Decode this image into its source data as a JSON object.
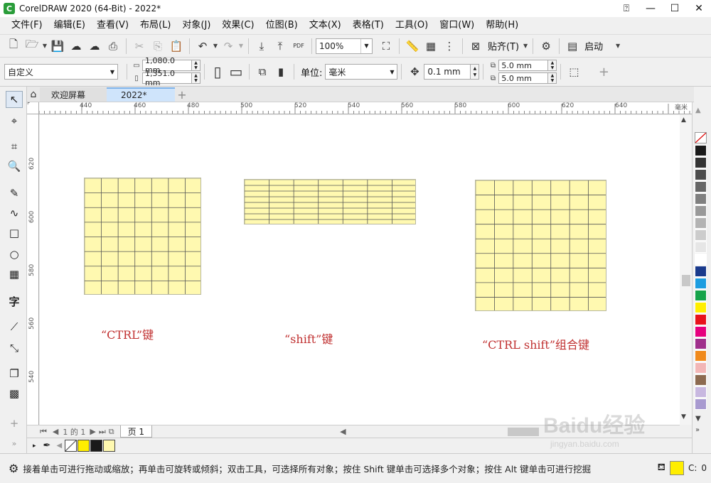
{
  "window": {
    "title": "CorelDRAW 2020 (64-Bit) - 2022*",
    "logo_glyph": "C",
    "controls": {
      "help": "⍰",
      "minimize": "—",
      "maximize": "☐",
      "close": "✕"
    }
  },
  "menu": [
    "文件(F)",
    "编辑(E)",
    "查看(V)",
    "布局(L)",
    "对象(J)",
    "效果(C)",
    "位图(B)",
    "文本(X)",
    "表格(T)",
    "工具(O)",
    "窗口(W)",
    "帮助(H)"
  ],
  "toolbar": {
    "zoom": "100%",
    "pdf_label": "PDF",
    "snap_label": "贴齐(T)",
    "launch_label": "启动"
  },
  "property_bar": {
    "preset": "自定义",
    "width": "1,080.0 mm",
    "height": "1,351.0 mm",
    "units_label": "单位:",
    "units": "毫米",
    "nudge": "0.1 mm",
    "dup_x": "5.0 mm",
    "dup_y": "5.0 mm"
  },
  "doc_tabs": {
    "welcome": "欢迎屏幕",
    "current": "2022*"
  },
  "ruler": {
    "h_labels": [
      "440",
      "460",
      "480",
      "500",
      "520",
      "540",
      "560",
      "580",
      "600",
      "620",
      "640"
    ],
    "h_unit": "毫米",
    "v_labels": [
      "620",
      "600",
      "580",
      "560",
      "540"
    ]
  },
  "canvas": {
    "captions": [
      "“CTRL”键",
      "“shift”键",
      "“CTRL shift”组合键"
    ]
  },
  "page_nav": {
    "page_of": "1 的 1",
    "page_tab": "页 1"
  },
  "status": {
    "hint": "接着单击可进行拖动或缩放；再单击可旋转或倾斜；双击工具，可选择所有对象；按住 Shift 键单击可选择多个对象；按住 Alt 键单击可进行挖掘",
    "fill_label": "C:",
    "fill_value": "0",
    "fill_color": "#ffee00"
  },
  "watermark": {
    "brand": "Baidu经验",
    "url": "jingyan.baidu.com"
  },
  "palette_colors": [
    "#ffffff",
    "#1a1a1a",
    "#333333",
    "#4d4d4d",
    "#666666",
    "#808080",
    "#999999",
    "#b3b3b3",
    "#cccccc",
    "#e6e6e6",
    "#ffffff",
    "#1a3a8c",
    "#1d9de0",
    "#16a34a",
    "#ffee00",
    "#e8121c",
    "#e6007e",
    "#a0308c",
    "#f08a1c",
    "#f2b6b6",
    "#8c6a50",
    "#c8b8e0",
    "#a89ad0"
  ],
  "doc_palette": [
    "#ffee00",
    "#1a1a1a",
    "#fff9b0"
  ]
}
